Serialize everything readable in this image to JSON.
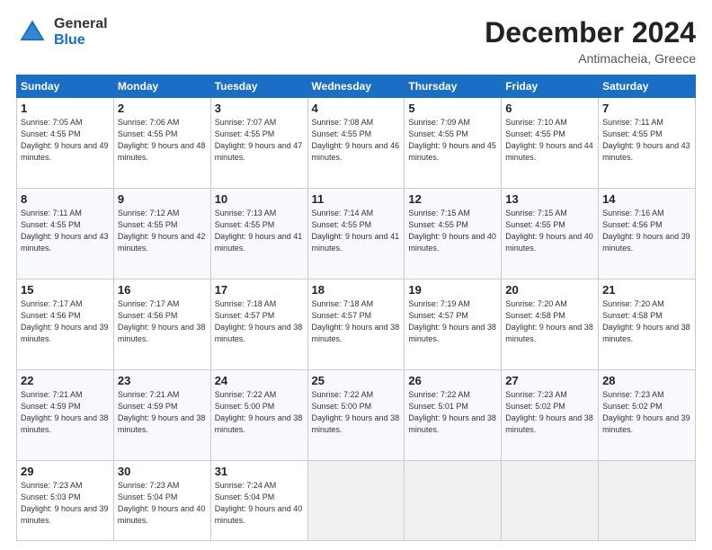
{
  "header": {
    "logo_general": "General",
    "logo_blue": "Blue",
    "month_title": "December 2024",
    "location": "Antimacheia, Greece"
  },
  "days_of_week": [
    "Sunday",
    "Monday",
    "Tuesday",
    "Wednesday",
    "Thursday",
    "Friday",
    "Saturday"
  ],
  "weeks": [
    [
      {
        "day": 1,
        "sunrise": "7:05 AM",
        "sunset": "4:55 PM",
        "daylight": "9 hours and 49 minutes."
      },
      {
        "day": 2,
        "sunrise": "7:06 AM",
        "sunset": "4:55 PM",
        "daylight": "9 hours and 48 minutes."
      },
      {
        "day": 3,
        "sunrise": "7:07 AM",
        "sunset": "4:55 PM",
        "daylight": "9 hours and 47 minutes."
      },
      {
        "day": 4,
        "sunrise": "7:08 AM",
        "sunset": "4:55 PM",
        "daylight": "9 hours and 46 minutes."
      },
      {
        "day": 5,
        "sunrise": "7:09 AM",
        "sunset": "4:55 PM",
        "daylight": "9 hours and 45 minutes."
      },
      {
        "day": 6,
        "sunrise": "7:10 AM",
        "sunset": "4:55 PM",
        "daylight": "9 hours and 44 minutes."
      },
      {
        "day": 7,
        "sunrise": "7:11 AM",
        "sunset": "4:55 PM",
        "daylight": "9 hours and 43 minutes."
      }
    ],
    [
      {
        "day": 8,
        "sunrise": "7:11 AM",
        "sunset": "4:55 PM",
        "daylight": "9 hours and 43 minutes."
      },
      {
        "day": 9,
        "sunrise": "7:12 AM",
        "sunset": "4:55 PM",
        "daylight": "9 hours and 42 minutes."
      },
      {
        "day": 10,
        "sunrise": "7:13 AM",
        "sunset": "4:55 PM",
        "daylight": "9 hours and 41 minutes."
      },
      {
        "day": 11,
        "sunrise": "7:14 AM",
        "sunset": "4:55 PM",
        "daylight": "9 hours and 41 minutes."
      },
      {
        "day": 12,
        "sunrise": "7:15 AM",
        "sunset": "4:55 PM",
        "daylight": "9 hours and 40 minutes."
      },
      {
        "day": 13,
        "sunrise": "7:15 AM",
        "sunset": "4:55 PM",
        "daylight": "9 hours and 40 minutes."
      },
      {
        "day": 14,
        "sunrise": "7:16 AM",
        "sunset": "4:56 PM",
        "daylight": "9 hours and 39 minutes."
      }
    ],
    [
      {
        "day": 15,
        "sunrise": "7:17 AM",
        "sunset": "4:56 PM",
        "daylight": "9 hours and 39 minutes."
      },
      {
        "day": 16,
        "sunrise": "7:17 AM",
        "sunset": "4:56 PM",
        "daylight": "9 hours and 38 minutes."
      },
      {
        "day": 17,
        "sunrise": "7:18 AM",
        "sunset": "4:57 PM",
        "daylight": "9 hours and 38 minutes."
      },
      {
        "day": 18,
        "sunrise": "7:18 AM",
        "sunset": "4:57 PM",
        "daylight": "9 hours and 38 minutes."
      },
      {
        "day": 19,
        "sunrise": "7:19 AM",
        "sunset": "4:57 PM",
        "daylight": "9 hours and 38 minutes."
      },
      {
        "day": 20,
        "sunrise": "7:20 AM",
        "sunset": "4:58 PM",
        "daylight": "9 hours and 38 minutes."
      },
      {
        "day": 21,
        "sunrise": "7:20 AM",
        "sunset": "4:58 PM",
        "daylight": "9 hours and 38 minutes."
      }
    ],
    [
      {
        "day": 22,
        "sunrise": "7:21 AM",
        "sunset": "4:59 PM",
        "daylight": "9 hours and 38 minutes."
      },
      {
        "day": 23,
        "sunrise": "7:21 AM",
        "sunset": "4:59 PM",
        "daylight": "9 hours and 38 minutes."
      },
      {
        "day": 24,
        "sunrise": "7:22 AM",
        "sunset": "5:00 PM",
        "daylight": "9 hours and 38 minutes."
      },
      {
        "day": 25,
        "sunrise": "7:22 AM",
        "sunset": "5:00 PM",
        "daylight": "9 hours and 38 minutes."
      },
      {
        "day": 26,
        "sunrise": "7:22 AM",
        "sunset": "5:01 PM",
        "daylight": "9 hours and 38 minutes."
      },
      {
        "day": 27,
        "sunrise": "7:23 AM",
        "sunset": "5:02 PM",
        "daylight": "9 hours and 38 minutes."
      },
      {
        "day": 28,
        "sunrise": "7:23 AM",
        "sunset": "5:02 PM",
        "daylight": "9 hours and 39 minutes."
      }
    ],
    [
      {
        "day": 29,
        "sunrise": "7:23 AM",
        "sunset": "5:03 PM",
        "daylight": "9 hours and 39 minutes."
      },
      {
        "day": 30,
        "sunrise": "7:23 AM",
        "sunset": "5:04 PM",
        "daylight": "9 hours and 40 minutes."
      },
      {
        "day": 31,
        "sunrise": "7:24 AM",
        "sunset": "5:04 PM",
        "daylight": "9 hours and 40 minutes."
      },
      null,
      null,
      null,
      null
    ]
  ]
}
